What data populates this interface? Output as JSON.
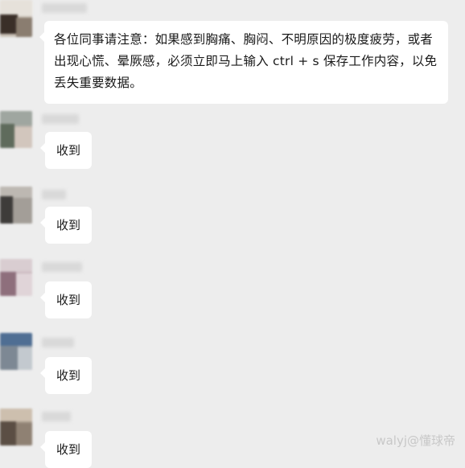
{
  "messages": [
    {
      "text": "各位同事请注意：如果感到胸痛、胸闷、不明原因的极度疲劳，或者出现心慌、晕厥感，必须立即马上输入 ctrl + s 保存工作内容，以免丢失重要数据。"
    },
    {
      "text": "收到"
    },
    {
      "text": "收到"
    },
    {
      "text": "收到"
    },
    {
      "text": "收到"
    },
    {
      "text": "收到"
    }
  ],
  "watermark": "walyj@懂球帝"
}
